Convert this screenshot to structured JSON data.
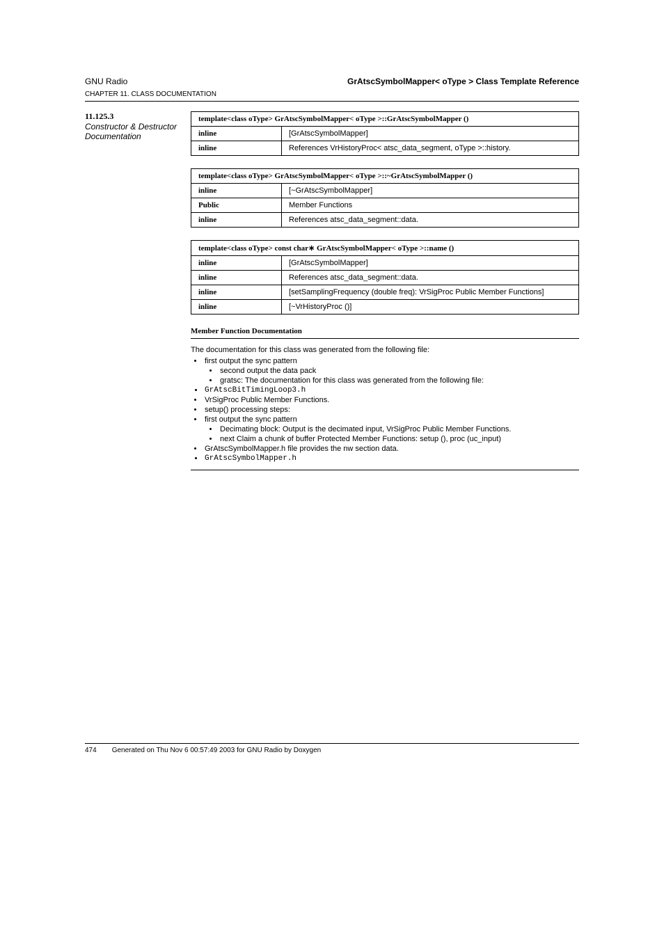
{
  "header": {
    "left_top": "GNU Radio",
    "left_sub": "CHAPTER 11. CLASS DOCUMENTATION",
    "right": "GrAtscSymbolMapper< oType > Class Template Reference"
  },
  "sidebar": {
    "structor_label": "Constructor & Destructor Documentation",
    "section_label": "11.125.3",
    "deps_label": "The documentation for this class was generated from the following file:"
  },
  "tables": [
    {
      "caption": "template<class oType> GrAtscSymbolMapper< oType >::GrAtscSymbolMapper ()",
      "rows": [
        {
          "k": "inline",
          "v": "[GrAtscSymbolMapper]"
        },
        {
          "k": "inline",
          "v": "References VrHistoryProc< atsc_data_segment, oType >::history."
        }
      ]
    },
    {
      "caption": "template<class oType> GrAtscSymbolMapper< oType >::~GrAtscSymbolMapper ()",
      "rows": [
        {
          "k": "inline",
          "v": "[~GrAtscSymbolMapper]"
        },
        {
          "k": "Public",
          "v": "Member Functions"
        },
        {
          "k": "inline",
          "v": "References atsc_data_segment::data."
        }
      ]
    },
    {
      "caption": "template<class oType> const char∗ GrAtscSymbolMapper< oType >::name ()",
      "rows": [
        {
          "k": "inline",
          "v": "[GrAtscSymbolMapper]"
        },
        {
          "k": "inline",
          "v": "References atsc_data_segment::data."
        },
        {
          "k": "inline",
          "v": "[setSamplingFrequency (double freq): VrSigProc Public Member Functions]"
        },
        {
          "k": "inline",
          "v": "[~VrHistoryProc ()]"
        }
      ]
    }
  ],
  "member_label": "Member Function Documentation",
  "deps": {
    "items": [
      {
        "text": "first output the sync pattern",
        "children": [
          {
            "text": "second output the data pack"
          },
          {
            "text": "gratsc: The documentation for this class was generated from the following file:"
          }
        ]
      },
      {
        "text": "GrAtscBitTimingLoop3.h"
      },
      {
        "text": "VrSigProc Public Member Functions."
      },
      {
        "text": "setup() processing steps:"
      },
      {
        "text": "first output the sync pattern",
        "children": [
          {
            "text": "Decimating block: Output is the decimated input, VrSigProc Public Member Functions."
          },
          {
            "text": "next Claim a chunk of buffer Protected Member Functions: setup (), proc (uc_input)"
          }
        ]
      },
      {
        "text": "GrAtscSymbolMapper.h file provides the nw section data."
      },
      {
        "text": "GrAtscSymbolMapper.h"
      }
    ]
  },
  "footer": {
    "page": "474",
    "generated": "Generated on Thu Nov 6 00:57:49 2003 for GNU Radio by Doxygen"
  }
}
